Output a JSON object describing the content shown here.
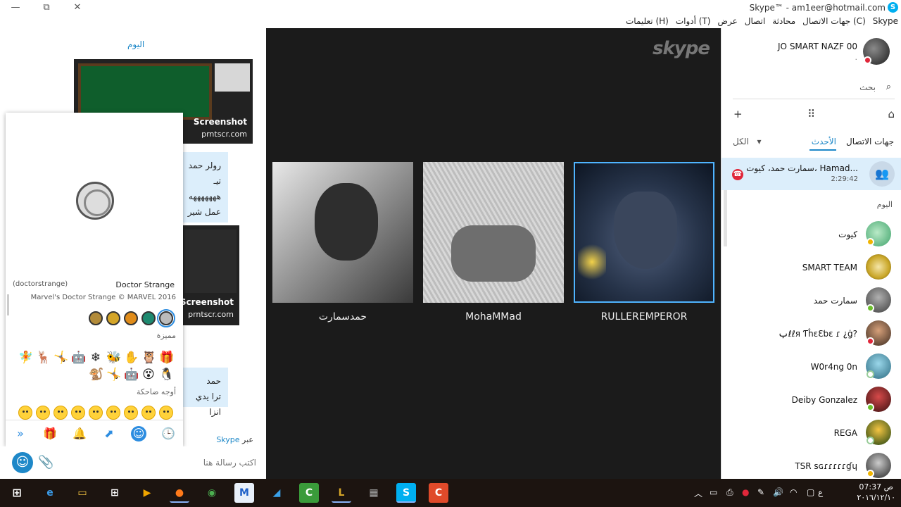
{
  "titlebar": {
    "title": "Skype™ - am1eer@hotmail.com",
    "minimize": "—",
    "restore": "⧉"
  },
  "menu": [
    "Skype",
    "جهات الاتصال (C)",
    "محادثة",
    "اتصال",
    "عرض",
    "أدوات (T)",
    "تعليمات (H)"
  ],
  "chat": {
    "day_label": "اليوم",
    "card1": {
      "caption": "Screenshot",
      "source": "prntscr.com"
    },
    "card2": {
      "caption": "Screenshot",
      "source": "prntscr.com"
    },
    "bubble1": [
      "رولر حمد تيـ",
      "هههههههه",
      "عمل شير",
      "هههههه"
    ],
    "bubble2": [
      "حمد",
      "ترا يدي انزا"
    ]
  },
  "picker": {
    "preview_name": "Doctor Strange",
    "preview_code": "(doctorstrange)",
    "preview_copyright": "Marvel's Doctor Strange © MARVEL 2016",
    "section_featured": "مميزة",
    "section_smileys": "أوجه ضاحكة",
    "featured_row1": [
      "🧚",
      "🦌",
      "🤸",
      "🤖",
      "❄",
      "🐝",
      "✋",
      "🦉",
      "🎁"
    ],
    "featured_row2": [
      "🐒",
      "🤸",
      "🤖",
      "😵",
      "🐧"
    ]
  },
  "compose": {
    "via_prefix": "عبر",
    "via_link": "Skype",
    "placeholder": "اكتب رسالة هنا"
  },
  "video": {
    "watermark": "skype",
    "participants": [
      {
        "name": "حمدسمارت"
      },
      {
        "name": "MohaMMad"
      },
      {
        "name": "RULLEREMPEROR"
      }
    ]
  },
  "profile": {
    "name": "JO SMART NAZF 00",
    "mood": "."
  },
  "search": {
    "label": "بحث"
  },
  "tabs": {
    "contacts": "جهات الاتصال",
    "recent": "الأحدث",
    "filter": "الكل"
  },
  "conversation": {
    "title": "سمارت حمد، كيوت، Hamad...",
    "time": "2:29:42"
  },
  "today_label": "اليوم",
  "contacts": [
    {
      "name": "كيوت",
      "status": "yellow"
    },
    {
      "name": "SMART TEAM",
      "status": "none"
    },
    {
      "name": "سمارت حمد",
      "status": "green"
    },
    {
      "name": "ݕℓℓя ƬĥɛƐƅɛ ɾ ¿ġ?",
      "status": "red"
    },
    {
      "name": "W0r4ng 0n",
      "status": "grey"
    },
    {
      "name": "Deiby Gonzalez",
      "status": "green"
    },
    {
      "name": "REGA",
      "status": "grey"
    },
    {
      "name": "TSR ꜱɢɾɾɾɾɾɠɥ",
      "status": "yellow"
    }
  ],
  "clock": {
    "time": "07:37 ص",
    "date": "٢٠١٦/١٢/١٠"
  },
  "tray": {
    "lang": "ع"
  }
}
